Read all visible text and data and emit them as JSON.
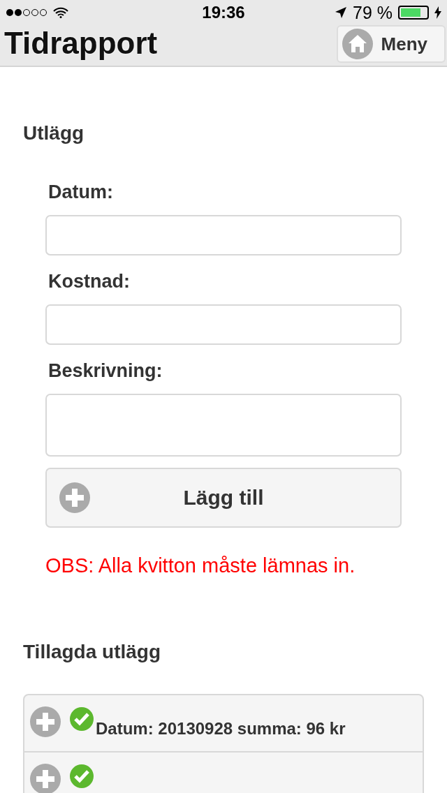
{
  "status_bar": {
    "time": "19:36",
    "battery_text": "79 %",
    "charging": true
  },
  "header": {
    "title": "Tidrapport",
    "menu_button": "Meny"
  },
  "section_title": "Utlägg",
  "form": {
    "fields": [
      {
        "label": "Datum:",
        "kind": "input"
      },
      {
        "label": "Kostnad:",
        "kind": "input"
      },
      {
        "label": "Beskrivning:",
        "kind": "textarea"
      }
    ],
    "add_button": "Lägg till",
    "notice": "OBS: Alla kvitton måste lämnas in."
  },
  "list_title": "Tillagda utlägg",
  "items": [
    {
      "text": "Datum: 20130928 summa: 96 kr",
      "approved": true
    },
    {
      "approved": true
    }
  ]
}
